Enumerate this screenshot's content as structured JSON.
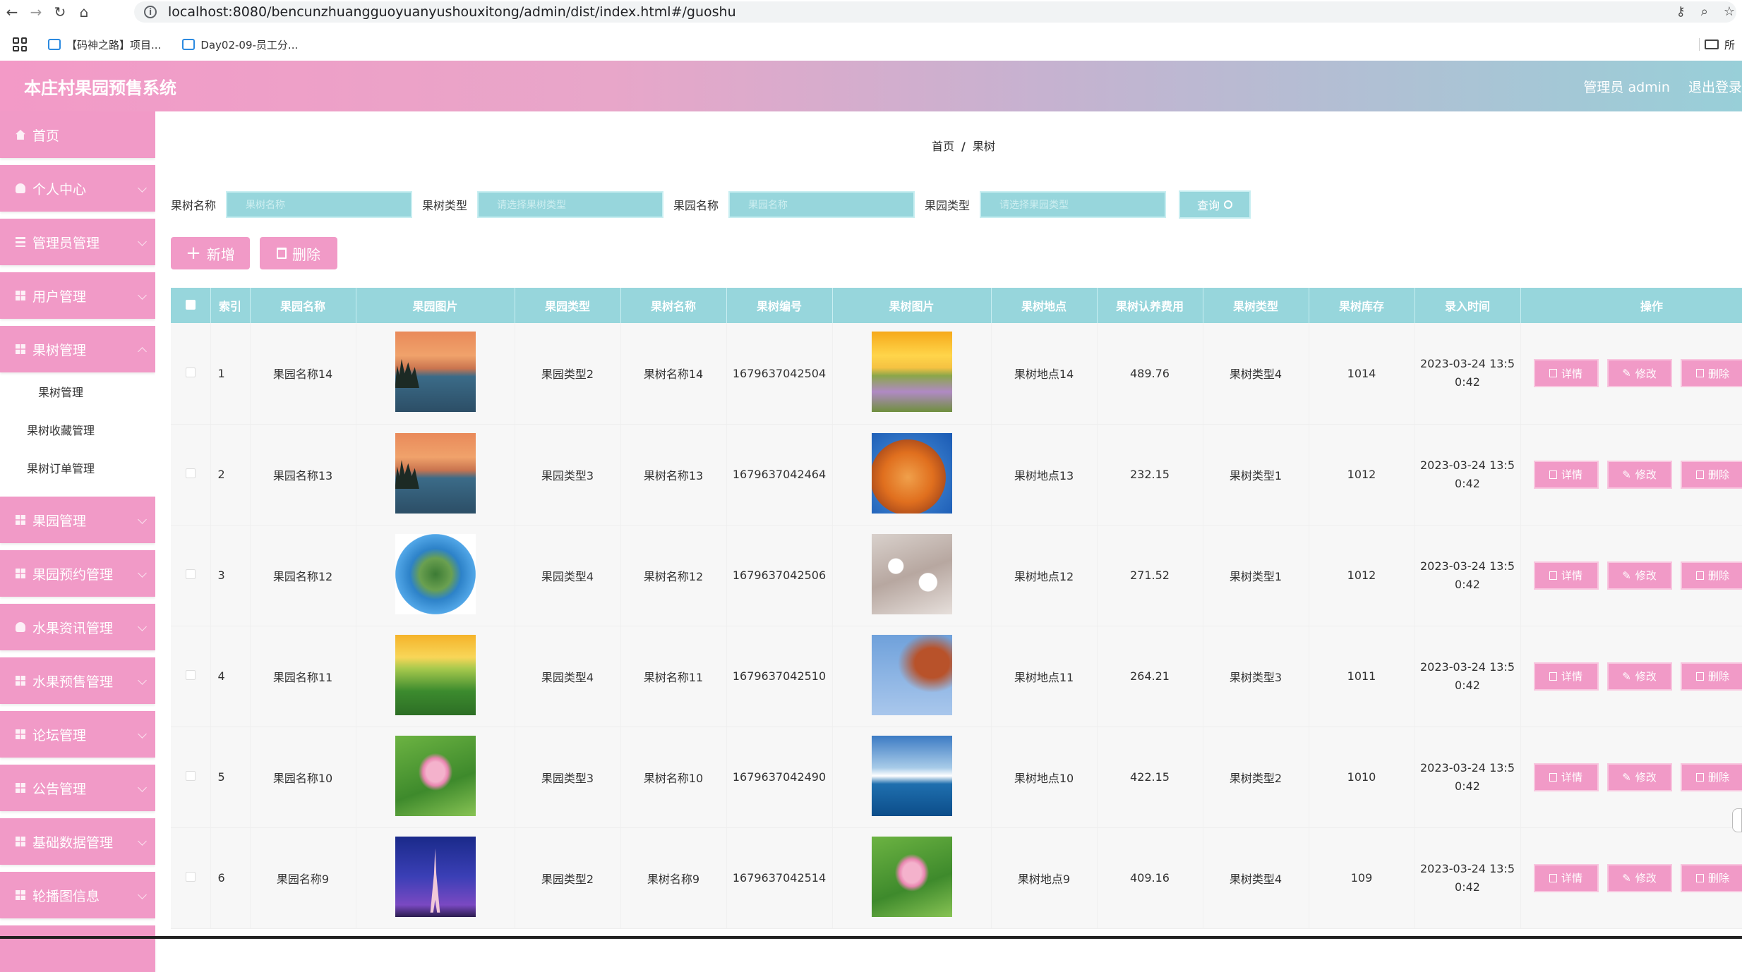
{
  "browser": {
    "url": "localhost:8080/bencunzhuangguoyuanyushouxitong/admin/dist/index.html#/guoshu",
    "bookmarks": [
      "【码神之路】项目...",
      "Day02-09-员工分..."
    ],
    "folder_label": "所"
  },
  "header": {
    "title": "本庄村果园预售系统",
    "user": "管理员 admin",
    "logout": "退出登录"
  },
  "sidebar": {
    "items": [
      {
        "label": "首页",
        "icon": "home-icon"
      },
      {
        "label": "个人中心",
        "icon": "user-icon"
      },
      {
        "label": "管理员管理",
        "icon": "list-icon"
      },
      {
        "label": "用户管理",
        "icon": "grid-icon"
      },
      {
        "label": "果树管理",
        "icon": "grid-icon"
      }
    ],
    "subitems": [
      "果树管理",
      "果树收藏管理",
      "果树订单管理"
    ],
    "items_after": [
      {
        "label": "果园管理",
        "icon": "grid-icon"
      },
      {
        "label": "果园预约管理",
        "icon": "grid-icon"
      },
      {
        "label": "水果资讯管理",
        "icon": "user-icon"
      },
      {
        "label": "水果预售管理",
        "icon": "grid-icon"
      },
      {
        "label": "论坛管理",
        "icon": "grid-icon"
      },
      {
        "label": "公告管理",
        "icon": "grid-icon"
      },
      {
        "label": "基础数据管理",
        "icon": "grid-icon"
      },
      {
        "label": "轮播图信息",
        "icon": "grid-icon"
      }
    ]
  },
  "breadcrumb": {
    "home": "首页",
    "sep": "/",
    "current": "果树"
  },
  "search": {
    "fields": [
      {
        "label": "果树名称",
        "placeholder": "果树名称"
      },
      {
        "label": "果树类型",
        "placeholder": "请选择果树类型"
      },
      {
        "label": "果园名称",
        "placeholder": "果园名称"
      },
      {
        "label": "果园类型",
        "placeholder": "请选择果园类型"
      }
    ],
    "button": "查询"
  },
  "actions": {
    "add": "新增",
    "delete": "删除"
  },
  "table": {
    "headers": [
      "索引",
      "果园名称",
      "果园图片",
      "果园类型",
      "果树名称",
      "果树编号",
      "果树图片",
      "果树地点",
      "果树认养费用",
      "果树类型",
      "果树库存",
      "录入时间",
      "操作"
    ],
    "ops": {
      "detail": "详情",
      "edit": "修改",
      "delete": "删除"
    },
    "rows": [
      {
        "index": "1",
        "orchard": "果园名称14",
        "orchard_img": "img-lake",
        "orchard_type": "果园类型2",
        "tree": "果树名称14",
        "code": "1679637042504",
        "tree_img": "img-sunset",
        "place": "果树地点14",
        "fee": "489.76",
        "tree_type": "果树类型4",
        "stock": "1014",
        "time1": "2023-03-24 13:5",
        "time2": "0:42"
      },
      {
        "index": "2",
        "orchard": "果园名称13",
        "orchard_img": "img-lake",
        "orchard_type": "果园类型3",
        "tree": "果树名称13",
        "code": "1679637042464",
        "tree_img": "img-rock",
        "place": "果树地点13",
        "fee": "232.15",
        "tree_type": "果树类型1",
        "stock": "1012",
        "time1": "2023-03-24 13:5",
        "time2": "0:42"
      },
      {
        "index": "3",
        "orchard": "果园名称12",
        "orchard_img": "img-planet",
        "orchard_type": "果园类型4",
        "tree": "果树名称12",
        "code": "1679637042506",
        "tree_img": "img-blossom",
        "place": "果树地点12",
        "fee": "271.52",
        "tree_type": "果树类型1",
        "stock": "1012",
        "time1": "2023-03-24 13:5",
        "time2": "0:42"
      },
      {
        "index": "4",
        "orchard": "果园名称11",
        "orchard_img": "img-meadow",
        "orchard_type": "果园类型4",
        "tree": "果树名称11",
        "code": "1679637042510",
        "tree_img": "img-leaves",
        "place": "果树地点11",
        "fee": "264.21",
        "tree_type": "果树类型3",
        "stock": "1011",
        "time1": "2023-03-24 13:5",
        "time2": "0:42"
      },
      {
        "index": "5",
        "orchard": "果园名称10",
        "orchard_img": "img-lotus",
        "orchard_type": "果园类型3",
        "tree": "果树名称10",
        "code": "1679637042490",
        "tree_img": "img-sea",
        "place": "果树地点10",
        "fee": "422.15",
        "tree_type": "果树类型2",
        "stock": "1010",
        "time1": "2023-03-24 13:5",
        "time2": "0:42"
      },
      {
        "index": "6",
        "orchard": "果园名称9",
        "orchard_img": "img-tower",
        "orchard_type": "果园类型2",
        "tree": "果树名称9",
        "code": "1679637042514",
        "tree_img": "img-lotus",
        "place": "果树地点9",
        "fee": "409.16",
        "tree_type": "果树类型4",
        "stock": "109",
        "time1": "2023-03-24 13:5",
        "time2": "0:42"
      }
    ]
  },
  "colors": {
    "primary_pink": "#f19ac7",
    "teal": "#97d6dc"
  }
}
